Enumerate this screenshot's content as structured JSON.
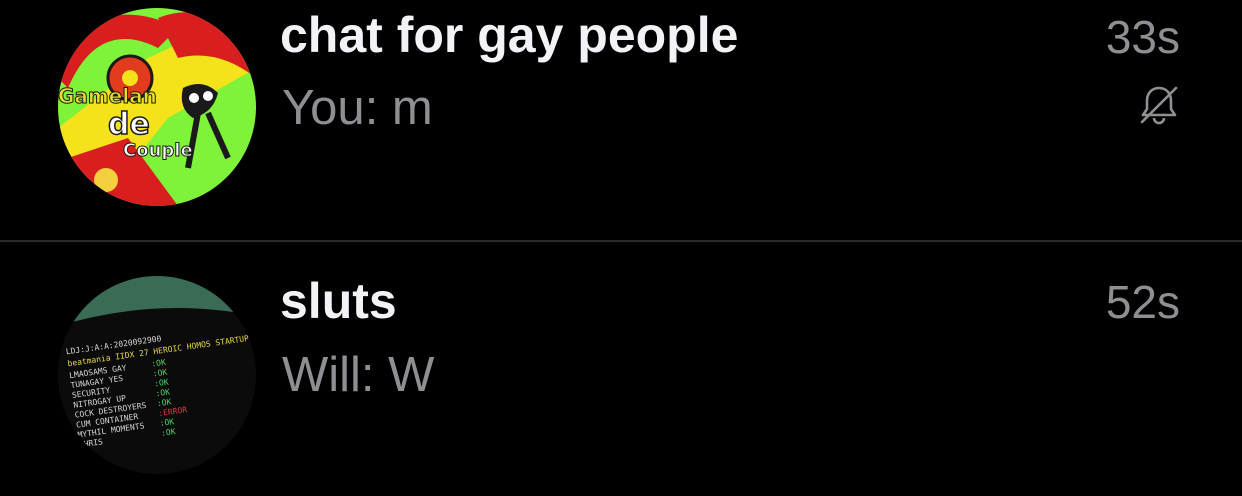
{
  "chats": [
    {
      "title": "chat for gay people",
      "preview": "You: m",
      "time": "33s",
      "muted": true,
      "avatar": {
        "icon": "sticker-art-avatar",
        "colors": [
          "#7ff23a",
          "#d81e1e",
          "#f4e21a",
          "#1a1a1a"
        ],
        "text_lines": [
          "Gamelan",
          "de",
          "Couple"
        ]
      }
    },
    {
      "title": "sluts",
      "preview": "Will: W",
      "time": "52s",
      "muted": false,
      "avatar": {
        "icon": "terminal-screen-avatar",
        "colors": [
          "#0b0b0b",
          "#3a6b55",
          "#e8d84a",
          "#4cd864",
          "#e23b3b"
        ],
        "screen_lines": [
          {
            "label": "LDJ:J:A:A:2020092900",
            "status": ""
          },
          {
            "label": "beatmania IIDX 27 HEROIC HOMOS STARTUP",
            "status": ""
          },
          {
            "label": "LMAOSAMS GAY",
            "status": ":OK"
          },
          {
            "label": "TUNAGAY YES",
            "status": ":OK"
          },
          {
            "label": "SECURITY",
            "status": ":OK"
          },
          {
            "label": "NITROGAY UP",
            "status": ":OK"
          },
          {
            "label": "COCK DESTROYERS",
            "status": ":OK"
          },
          {
            "label": "CUM CONTAINER",
            "status": ":ERROR"
          },
          {
            "label": "MYTHIL MOMENTS",
            "status": ":OK"
          },
          {
            "label": "CHRIS",
            "status": ":OK"
          }
        ]
      }
    }
  ]
}
